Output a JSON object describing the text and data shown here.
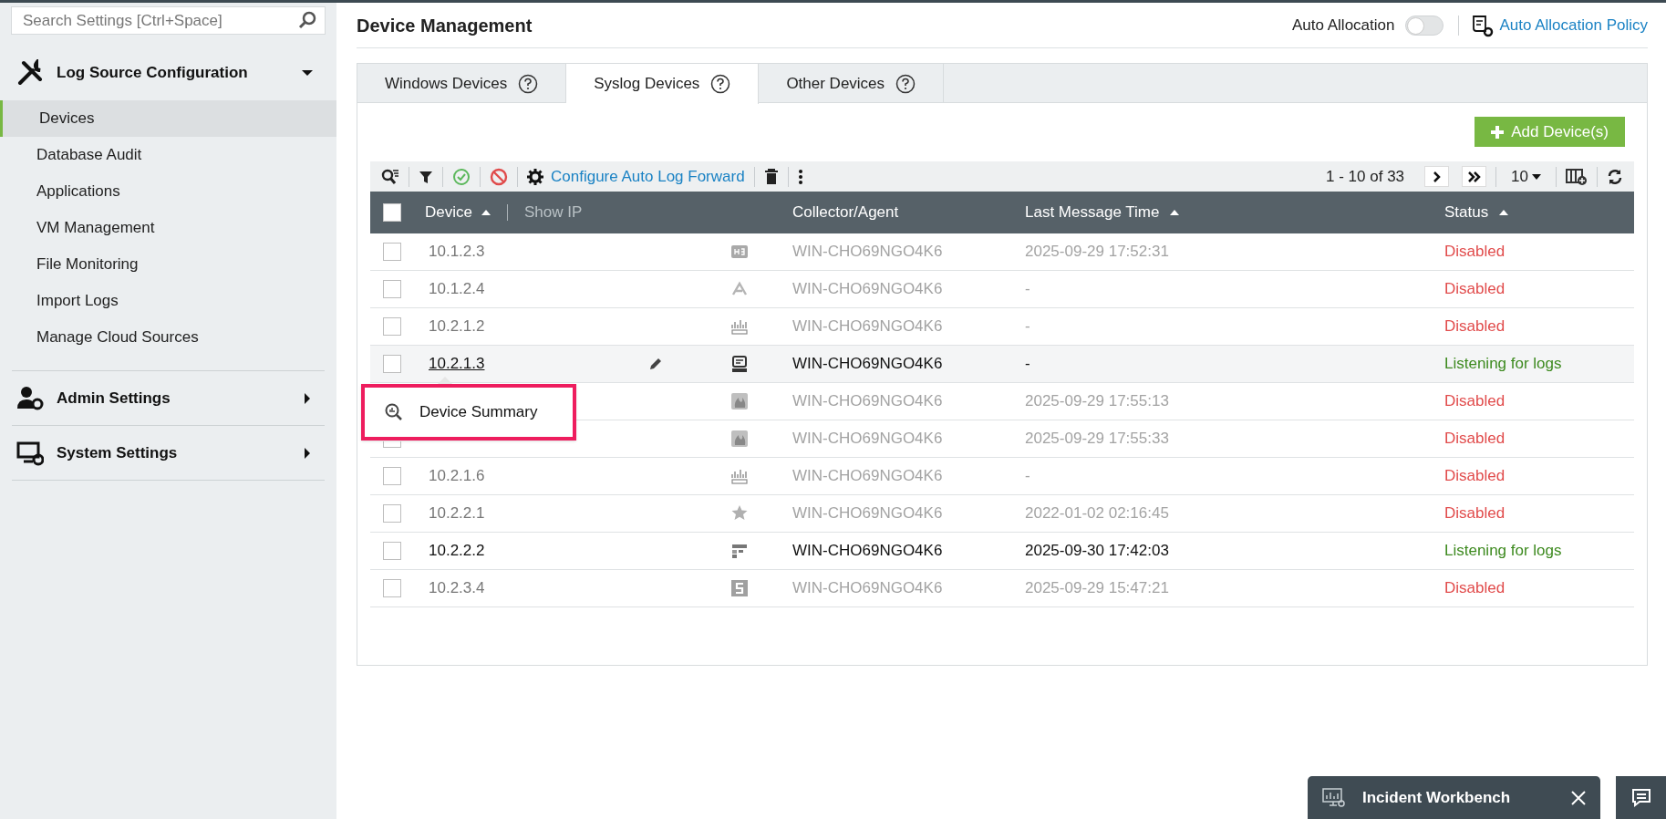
{
  "search": {
    "placeholder": "Search Settings [Ctrl+Space]"
  },
  "sidebar": {
    "sections": [
      {
        "label": "Log Source Configuration",
        "expanded": true,
        "items": [
          {
            "label": "Devices",
            "selected": true
          },
          {
            "label": "Database Audit",
            "selected": false
          },
          {
            "label": "Applications",
            "selected": false
          },
          {
            "label": "VM Management",
            "selected": false
          },
          {
            "label": "File Monitoring",
            "selected": false
          },
          {
            "label": "Import Logs",
            "selected": false
          },
          {
            "label": "Manage Cloud Sources",
            "selected": false
          }
        ]
      },
      {
        "label": "Admin Settings",
        "expanded": false
      },
      {
        "label": "System Settings",
        "expanded": false
      }
    ]
  },
  "header": {
    "title": "Device Management",
    "auto_allocation": {
      "label": "Auto Allocation",
      "on": false
    },
    "policy_link": "Auto Allocation Policy"
  },
  "tabs": [
    {
      "label": "Windows Devices",
      "selected": false
    },
    {
      "label": "Syslog Devices",
      "selected": true
    },
    {
      "label": "Other Devices",
      "selected": false
    }
  ],
  "add_button": "Add Device(s)",
  "toolbar": {
    "configure_link": "Configure Auto Log Forward",
    "range": "1 - 10 of 33",
    "page_size": "10"
  },
  "table": {
    "select_all_checked": false,
    "columns": {
      "device": "Device",
      "show_ip": "Show IP",
      "collector": "Collector/Agent",
      "last_message": "Last Message Time",
      "status": "Status"
    },
    "rows": [
      {
        "device": "10.1.2.3",
        "kind": "h3c",
        "collector": "WIN-CHO69NGO4K6",
        "last_message": "2025-09-29 17:52:31",
        "status": "Disabled",
        "active": false,
        "hovered": false,
        "checked": false
      },
      {
        "device": "10.1.2.4",
        "kind": "chevron",
        "collector": "WIN-CHO69NGO4K6",
        "last_message": "-",
        "status": "Disabled",
        "active": false,
        "hovered": false,
        "checked": false
      },
      {
        "device": "10.2.1.2",
        "kind": "bars",
        "collector": "WIN-CHO69NGO4K6",
        "last_message": "-",
        "status": "Disabled",
        "active": false,
        "hovered": false,
        "checked": false
      },
      {
        "device": "10.2.1.3",
        "kind": "terminal",
        "collector": "WIN-CHO69NGO4K6",
        "last_message": "-",
        "status": "Listening for logs",
        "active": true,
        "hovered": true,
        "checked": false
      },
      {
        "kind": "flame",
        "collector": "WIN-CHO69NGO4K6",
        "last_message": "2025-09-29 17:55:13",
        "status": "Disabled",
        "active": false,
        "hovered": false
      },
      {
        "kind": "flame",
        "collector": "WIN-CHO69NGO4K6",
        "last_message": "2025-09-29 17:55:33",
        "status": "Disabled",
        "active": false,
        "hovered": false,
        "checked": false
      },
      {
        "device": "10.2.1.6",
        "kind": "bars",
        "collector": "WIN-CHO69NGO4K6",
        "last_message": "-",
        "status": "Disabled",
        "active": false,
        "hovered": false,
        "checked": false
      },
      {
        "device": "10.2.2.1",
        "kind": "star",
        "collector": "WIN-CHO69NGO4K6",
        "last_message": "2022-01-02 02:16:45",
        "status": "Disabled",
        "active": false,
        "hovered": false,
        "checked": false
      },
      {
        "device": "10.2.2.2",
        "kind": "blocks",
        "collector": "WIN-CHO69NGO4K6",
        "last_message": "2025-09-30 17:42:03",
        "status": "Listening for logs",
        "active": true,
        "hovered": false,
        "checked": false
      },
      {
        "device": "10.2.3.4",
        "kind": "square",
        "collector": "WIN-CHO69NGO4K6",
        "last_message": "2025-09-29 15:47:21",
        "status": "Disabled",
        "active": false,
        "hovered": false,
        "checked": false
      }
    ]
  },
  "popup": {
    "label": "Device Summary"
  },
  "dock": {
    "label": "Incident Workbench"
  }
}
